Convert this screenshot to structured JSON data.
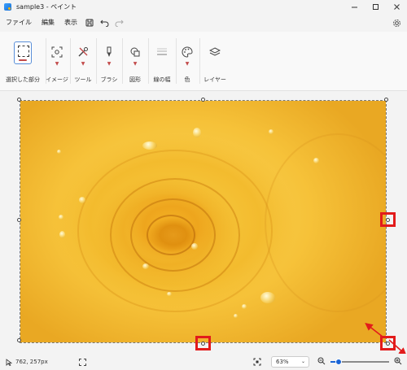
{
  "window": {
    "title": "sample3 - ペイント",
    "minimize_icon": "minimize-icon",
    "maximize_icon": "maximize-icon",
    "close_icon": "close-icon"
  },
  "menu": {
    "items": [
      "ファイル",
      "編集",
      "表示"
    ],
    "icons": [
      "save-icon",
      "undo-icon",
      "redo-icon"
    ],
    "settings_icon": "gear-icon"
  },
  "ribbon": {
    "groups": [
      {
        "label": "選択した部分",
        "icon": "select-icon"
      },
      {
        "label": "イメージ",
        "icon": "image-icon"
      },
      {
        "label": "ツール",
        "icon": "tools-icon"
      },
      {
        "label": "ブラシ",
        "icon": "brush-icon"
      },
      {
        "label": "図形",
        "icon": "shapes-icon"
      },
      {
        "label": "線の幅",
        "icon": "line-width-icon"
      },
      {
        "label": "色",
        "icon": "palette-icon"
      },
      {
        "label": "レイヤー",
        "icon": "layers-icon"
      }
    ]
  },
  "status": {
    "cursor_position": "762, 257px",
    "zoom_value": "63%",
    "zoom_level": 0.14
  },
  "colors": {
    "accent": "#1a64d6",
    "highlight": "#e21b1b"
  }
}
